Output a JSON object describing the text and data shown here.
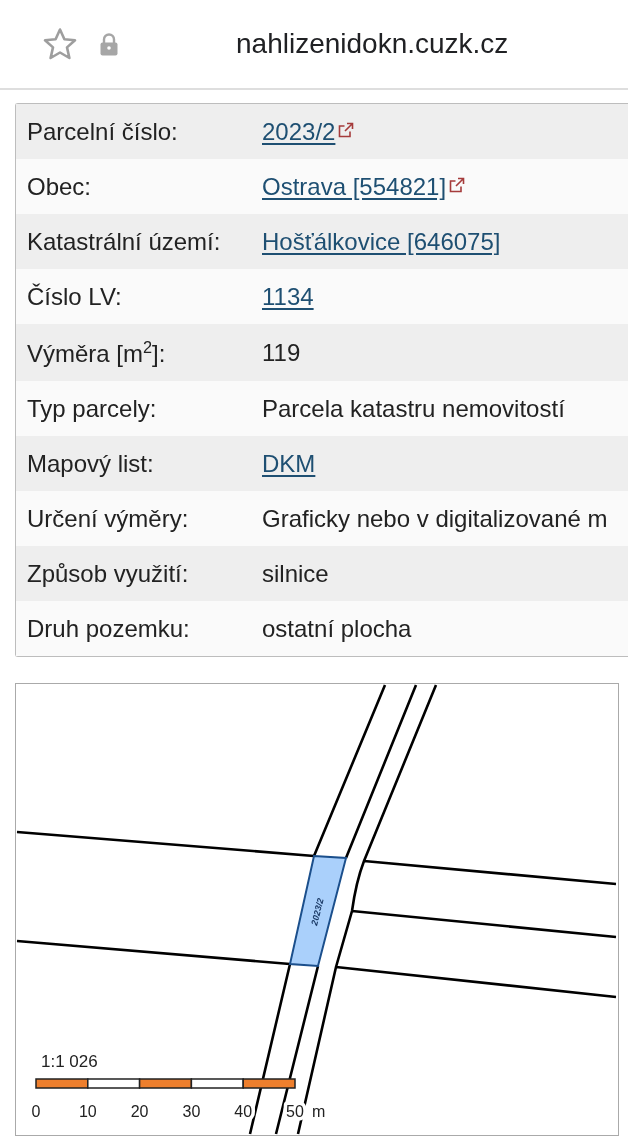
{
  "browser_bar": {
    "url": "nahlizenidokn.cuzk.cz"
  },
  "parcel_details": {
    "rows": [
      {
        "label": "Parcelní číslo:",
        "value": "2023/2",
        "kind": "external-link"
      },
      {
        "label": "Obec:",
        "value": "Ostrava [554821]",
        "kind": "external-link"
      },
      {
        "label": "Katastrální území:",
        "value": "Hošťálkovice [646075]",
        "kind": "link"
      },
      {
        "label": "Číslo LV:",
        "value": "1134",
        "kind": "link"
      },
      {
        "label": "Výměra [m$^{2}$]:",
        "value": "119",
        "kind": "text"
      },
      {
        "label": "Typ parcely:",
        "value": "Parcela katastru nemovitostí",
        "kind": "text"
      },
      {
        "label": "Mapový list:",
        "value": "DKM",
        "kind": "link"
      },
      {
        "label": "Určení výměry:",
        "value": "Graficky nebo v digitalizované m",
        "kind": "text"
      },
      {
        "label": "Způsob využití:",
        "value": "silnice",
        "kind": "text"
      },
      {
        "label": "Druh pozemku:",
        "value": "ostatní plocha",
        "kind": "text"
      }
    ]
  },
  "map": {
    "parcel_label": "2023/2",
    "scale": "1:1 026",
    "scale_ticks": [
      "0",
      "10",
      "20",
      "30",
      "40",
      "50"
    ],
    "scale_unit": "m"
  }
}
